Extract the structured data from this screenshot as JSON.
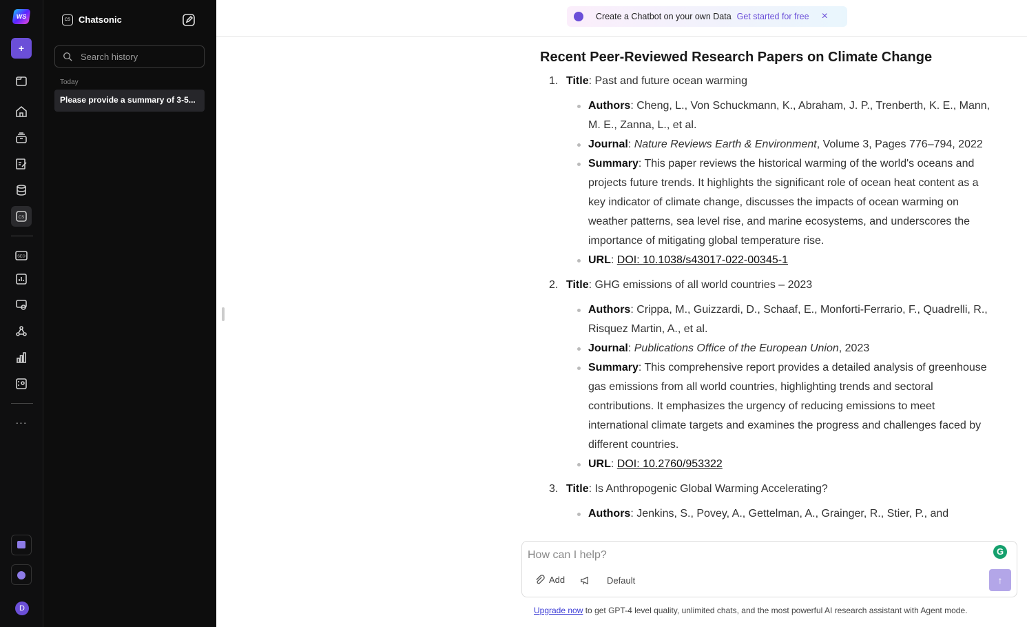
{
  "rail": {
    "logo": "WS",
    "new_label": "+",
    "items": [
      "folder-icon",
      "home-icon",
      "archive-icon",
      "edit-doc-icon",
      "database-icon",
      "chatsonic-icon",
      "seo-icon",
      "analytics-icon",
      "chat-settings-icon",
      "network-icon",
      "bar-chart-icon",
      "report-icon"
    ],
    "more": "···",
    "user_initial": "D"
  },
  "panel": {
    "title": "Chatsonic",
    "logo": "CS",
    "search_placeholder": "Search history",
    "section": "Today",
    "history": [
      "Please provide a summary of 3-5..."
    ]
  },
  "banner": {
    "text": "Create a Chatbot on your own Data",
    "link": "Get started for free",
    "close": "×"
  },
  "content": {
    "heading": "Recent Peer-Reviewed Research Papers on Climate Change",
    "papers": [
      {
        "num": "1.",
        "title_label": "Title",
        "title": ": Past and future ocean warming",
        "authors_label": "Authors",
        "authors": ": Cheng, L., Von Schuckmann, K., Abraham, J. P., Trenberth, K. E., Mann, M. E., Zanna, L., et al.",
        "journal_label": "Journal",
        "journal_sep": ": ",
        "journal": "Nature Reviews Earth & Environment",
        "journal_rest": ", Volume 3, Pages 776–794, 2022",
        "summary_label": "Summary",
        "summary": ": This paper reviews the historical warming of the world's oceans and projects future trends. It highlights the significant role of ocean heat content as a key indicator of climate change, discusses the impacts of ocean warming on weather patterns, sea level rise, and marine ecosystems, and underscores the importance of mitigating global temperature rise.",
        "url_label": "URL",
        "url_sep": ": ",
        "url": "DOI: 10.1038/s43017-022-00345-1"
      },
      {
        "num": "2.",
        "title_label": "Title",
        "title": ": GHG emissions of all world countries – 2023",
        "authors_label": "Authors",
        "authors": ": Crippa, M., Guizzardi, D., Schaaf, E., Monforti-Ferrario, F., Quadrelli, R., Risquez Martin, A., et al.",
        "journal_label": "Journal",
        "journal_sep": ": ",
        "journal": "Publications Office of the European Union",
        "journal_rest": ", 2023",
        "summary_label": "Summary",
        "summary": ": This comprehensive report provides a detailed analysis of greenhouse gas emissions from all world countries, highlighting trends and sectoral contributions. It emphasizes the urgency of reducing emissions to meet international climate targets and examines the progress and challenges faced by different countries.",
        "url_label": "URL",
        "url_sep": ": ",
        "url": "DOI: 10.2760/953322"
      },
      {
        "num": "3.",
        "title_label": "Title",
        "title": ": Is Anthropogenic Global Warming Accelerating?",
        "authors_label": "Authors",
        "authors": ": Jenkins, S., Povey, A., Gettelman, A., Grainger, R., Stier, P., and"
      }
    ]
  },
  "composer": {
    "placeholder": "How can I help?",
    "add": "Add",
    "mode": "Default"
  },
  "footer": {
    "link": "Upgrade now",
    "text": " to get GPT-4 level quality, unlimited chats, and the most powerful AI research assistant with Agent mode."
  },
  "colors": {
    "accent": "#6b4fd8",
    "send": "#b3a6e8"
  }
}
